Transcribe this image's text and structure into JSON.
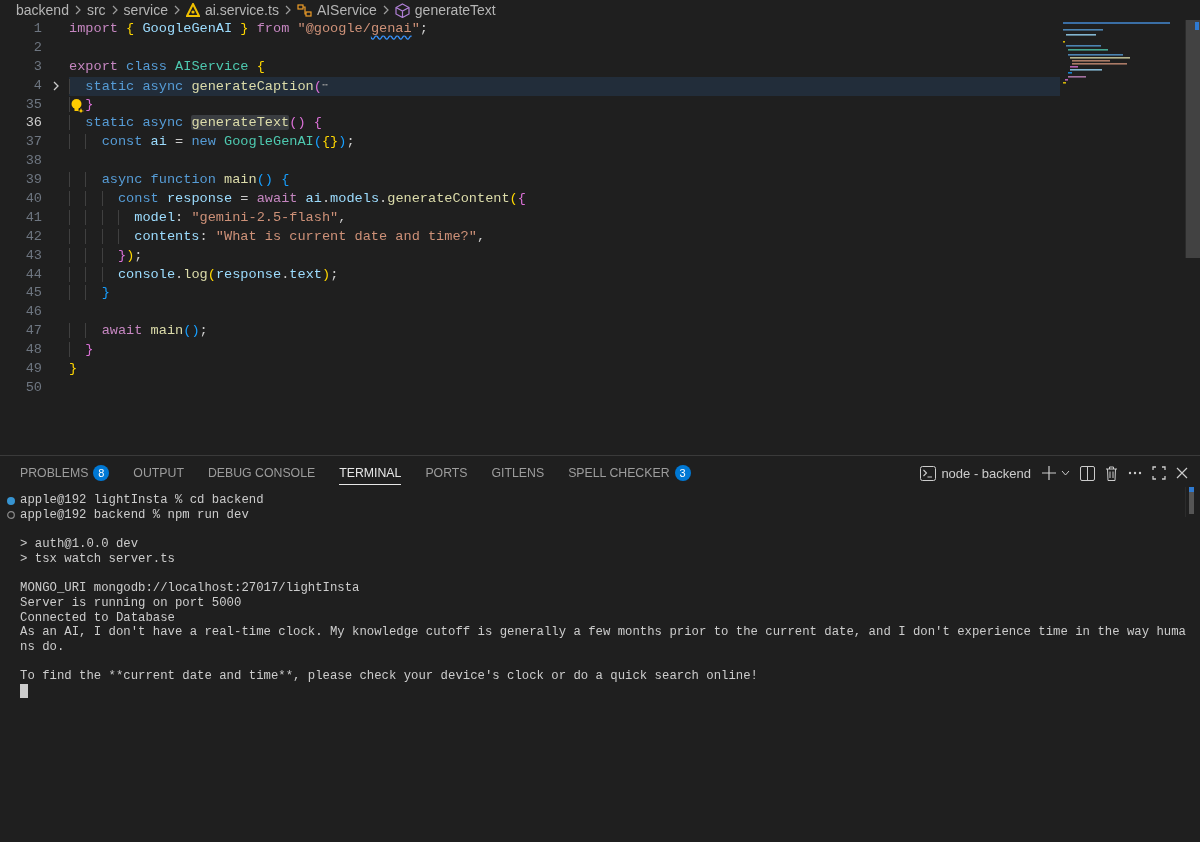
{
  "breadcrumb": [
    {
      "label": "backend",
      "kind": "folder"
    },
    {
      "label": "src",
      "kind": "folder"
    },
    {
      "label": "service",
      "kind": "folder"
    },
    {
      "label": "ai.service.ts",
      "kind": "file"
    },
    {
      "label": "AIService",
      "kind": "class"
    },
    {
      "label": "generateText",
      "kind": "method"
    }
  ],
  "editor": {
    "lines": [
      {
        "number": "1",
        "current": false,
        "cursor": false,
        "folded": false,
        "lightbulb": false,
        "tokens": [
          {
            "text": "import ",
            "kind": "ctrl"
          },
          {
            "text": "{ ",
            "kind": "b1"
          },
          {
            "text": "GoogleGenAI ",
            "kind": "var"
          },
          {
            "text": "} ",
            "kind": "b1"
          },
          {
            "text": "from ",
            "kind": "ctrl"
          },
          {
            "text": "\"@google/",
            "kind": "str"
          },
          {
            "text": "genai",
            "kind": "str-warning"
          },
          {
            "text": "\"",
            "kind": "str"
          },
          {
            "text": ";",
            "kind": "plain"
          }
        ]
      },
      {
        "number": "2",
        "current": false,
        "cursor": false,
        "folded": false,
        "lightbulb": false
      },
      {
        "number": "3",
        "current": false,
        "cursor": false,
        "folded": false,
        "lightbulb": false,
        "tokens": [
          {
            "text": "export ",
            "kind": "ctrl"
          },
          {
            "text": "class ",
            "kind": "kw"
          },
          {
            "text": "AIService ",
            "kind": "type"
          },
          {
            "text": "{",
            "kind": "b1"
          }
        ]
      },
      {
        "number": "4",
        "current": true,
        "cursor": false,
        "folded": true,
        "lightbulb": false,
        "tokens": [
          {
            "text": "  static ",
            "kind": "kw"
          },
          {
            "text": "async ",
            "kind": "kw"
          },
          {
            "text": "generateCaption",
            "kind": "fn"
          },
          {
            "text": "(",
            "kind": "b2"
          },
          {
            "text": "⋯",
            "kind": "fold"
          }
        ]
      },
      {
        "number": "35",
        "current": false,
        "cursor": false,
        "folded": false,
        "lightbulb": true,
        "tokens": [
          {
            "text": "  }",
            "kind": "b2"
          }
        ]
      },
      {
        "number": "36",
        "current": false,
        "cursor": true,
        "folded": false,
        "lightbulb": false,
        "tokens": [
          {
            "text": "  static ",
            "kind": "kw"
          },
          {
            "text": "async ",
            "kind": "kw"
          },
          {
            "text": "generateText",
            "kind": "fn-match"
          },
          {
            "text": "() ",
            "kind": "b2"
          },
          {
            "text": "{",
            "kind": "b2"
          }
        ]
      },
      {
        "number": "37",
        "current": false,
        "cursor": false,
        "folded": false,
        "lightbulb": false,
        "tokens": [
          {
            "text": "    const ",
            "kind": "kw"
          },
          {
            "text": "ai",
            "kind": "var"
          },
          {
            "text": " = ",
            "kind": "plain"
          },
          {
            "text": "new ",
            "kind": "kw"
          },
          {
            "text": "GoogleGenAI",
            "kind": "type"
          },
          {
            "text": "(",
            "kind": "b3"
          },
          {
            "text": "{}",
            "kind": "b1"
          },
          {
            "text": ")",
            "kind": "b3"
          },
          {
            "text": ";",
            "kind": "plain"
          }
        ]
      },
      {
        "number": "38",
        "current": false,
        "cursor": false,
        "folded": false,
        "lightbulb": false
      },
      {
        "number": "39",
        "current": false,
        "cursor": false,
        "folded": false,
        "lightbulb": false,
        "tokens": [
          {
            "text": "    async ",
            "kind": "kw"
          },
          {
            "text": "function ",
            "kind": "kw"
          },
          {
            "text": "main",
            "kind": "fn"
          },
          {
            "text": "() ",
            "kind": "b3"
          },
          {
            "text": "{",
            "kind": "b3"
          }
        ]
      },
      {
        "number": "40",
        "current": false,
        "cursor": false,
        "folded": false,
        "lightbulb": false,
        "tokens": [
          {
            "text": "      const ",
            "kind": "kw"
          },
          {
            "text": "response",
            "kind": "var"
          },
          {
            "text": " = ",
            "kind": "plain"
          },
          {
            "text": "await ",
            "kind": "ctrl"
          },
          {
            "text": "ai",
            "kind": "var"
          },
          {
            "text": ".",
            "kind": "plain"
          },
          {
            "text": "models",
            "kind": "var"
          },
          {
            "text": ".",
            "kind": "plain"
          },
          {
            "text": "generateContent",
            "kind": "fn"
          },
          {
            "text": "(",
            "kind": "b1"
          },
          {
            "text": "{",
            "kind": "b2"
          }
        ]
      },
      {
        "number": "41",
        "current": false,
        "cursor": false,
        "folded": false,
        "lightbulb": false,
        "tokens": [
          {
            "text": "        model",
            "kind": "var"
          },
          {
            "text": ": ",
            "kind": "plain"
          },
          {
            "text": "\"gemini-2.5-flash\"",
            "kind": "str"
          },
          {
            "text": ",",
            "kind": "plain"
          }
        ]
      },
      {
        "number": "42",
        "current": false,
        "cursor": false,
        "folded": false,
        "lightbulb": false,
        "tokens": [
          {
            "text": "        contents",
            "kind": "var"
          },
          {
            "text": ": ",
            "kind": "plain"
          },
          {
            "text": "\"What is current date and time?\"",
            "kind": "str"
          },
          {
            "text": ",",
            "kind": "plain"
          }
        ]
      },
      {
        "number": "43",
        "current": false,
        "cursor": false,
        "folded": false,
        "lightbulb": false,
        "tokens": [
          {
            "text": "      }",
            "kind": "b2"
          },
          {
            "text": ")",
            "kind": "b1"
          },
          {
            "text": ";",
            "kind": "plain"
          }
        ]
      },
      {
        "number": "44",
        "current": false,
        "cursor": false,
        "folded": false,
        "lightbulb": false,
        "tokens": [
          {
            "text": "      console",
            "kind": "var"
          },
          {
            "text": ".",
            "kind": "plain"
          },
          {
            "text": "log",
            "kind": "fn"
          },
          {
            "text": "(",
            "kind": "b1"
          },
          {
            "text": "response",
            "kind": "var"
          },
          {
            "text": ".",
            "kind": "plain"
          },
          {
            "text": "text",
            "kind": "var"
          },
          {
            "text": ")",
            "kind": "b1"
          },
          {
            "text": ";",
            "kind": "plain"
          }
        ]
      },
      {
        "number": "45",
        "current": false,
        "cursor": false,
        "folded": false,
        "lightbulb": false,
        "tokens": [
          {
            "text": "    }",
            "kind": "b3"
          }
        ]
      },
      {
        "number": "46",
        "current": false,
        "cursor": false,
        "folded": false,
        "lightbulb": false
      },
      {
        "number": "47",
        "current": false,
        "cursor": false,
        "folded": false,
        "lightbulb": false,
        "tokens": [
          {
            "text": "    await ",
            "kind": "ctrl"
          },
          {
            "text": "main",
            "kind": "fn"
          },
          {
            "text": "()",
            "kind": "b3"
          },
          {
            "text": ";",
            "kind": "plain"
          }
        ]
      },
      {
        "number": "48",
        "current": false,
        "cursor": false,
        "folded": false,
        "lightbulb": false,
        "tokens": [
          {
            "text": "  }",
            "kind": "b2"
          }
        ]
      },
      {
        "number": "49",
        "current": false,
        "cursor": false,
        "folded": false,
        "lightbulb": false,
        "tokens": [
          {
            "text": "}",
            "kind": "b1"
          }
        ]
      },
      {
        "number": "50",
        "current": false,
        "cursor": false,
        "folded": false,
        "lightbulb": false
      }
    ]
  },
  "panel": {
    "tabs": [
      {
        "label": "PROBLEMS",
        "selected": false,
        "badge": "8"
      },
      {
        "label": "OUTPUT",
        "selected": false
      },
      {
        "label": "DEBUG CONSOLE",
        "selected": false
      },
      {
        "label": "TERMINAL",
        "selected": true
      },
      {
        "label": "PORTS",
        "selected": false
      },
      {
        "label": "GITLENS",
        "selected": false
      },
      {
        "label": "SPELL CHECKER",
        "selected": false,
        "badge": "3"
      }
    ],
    "terminal_name": "node - backend",
    "terminal": [
      [
        {
          "text": "apple@192 lightInsta % cd backend",
          "kind": "command",
          "done": true
        },
        {
          "text": "apple@192 backend % npm run dev",
          "kind": "command",
          "done": false
        }
      ],
      [
        {
          "text": "> auth@1.0.0 dev",
          "kind": "output"
        },
        {
          "text": "> tsx watch server.ts",
          "kind": "output"
        }
      ],
      [
        {
          "text": "MONGO_URI mongodb://localhost:27017/lightInsta",
          "kind": "output"
        },
        {
          "text": "Server is running on port 5000",
          "kind": "output"
        },
        {
          "text": "Connected to Database",
          "kind": "output"
        },
        {
          "text": "As an AI, I don't have a real-time clock. My knowledge cutoff is generally a few months prior to the current date, and I don't experience time in the way huma",
          "kind": "output"
        },
        {
          "text": "ns do.",
          "kind": "output"
        }
      ],
      [
        {
          "text": "To find the **current date and time**, please check your device's clock or do a quick search online!",
          "kind": "output"
        }
      ]
    ]
  }
}
